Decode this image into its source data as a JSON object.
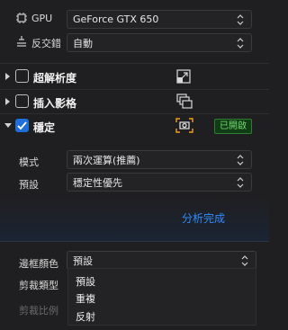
{
  "gpu": {
    "label": "GPU",
    "value": "GeForce GTX 650"
  },
  "antialias": {
    "label": "反交錯",
    "value": "自動"
  },
  "sections": {
    "super_resolution": {
      "title": "超解析度",
      "icon": "expand-arrows-icon"
    },
    "frame_insert": {
      "title": "插入影格",
      "icon": "layers-icon"
    },
    "stabilize": {
      "title": "穩定",
      "icon": "camera-scan-icon",
      "badge": "已開啟"
    }
  },
  "stabilize_settings": {
    "mode_label": "模式",
    "mode_value": "兩次運算(推薦)",
    "preset_label": "預設",
    "preset_value": "穩定性優先"
  },
  "analysis_status": "分析完成",
  "border": {
    "color_label": "邊框顏色",
    "color_value": "預設",
    "crop_type_label": "剪裁類型",
    "crop_ratio_label": "剪裁比例"
  },
  "dropdown": {
    "items": [
      "預設",
      "重複",
      "反射"
    ]
  },
  "colors": {
    "accent_blue": "#1e6fd9",
    "status_blue": "#2f8cff",
    "badge_green": "#6fdc6f",
    "background": "#1f1f21"
  }
}
